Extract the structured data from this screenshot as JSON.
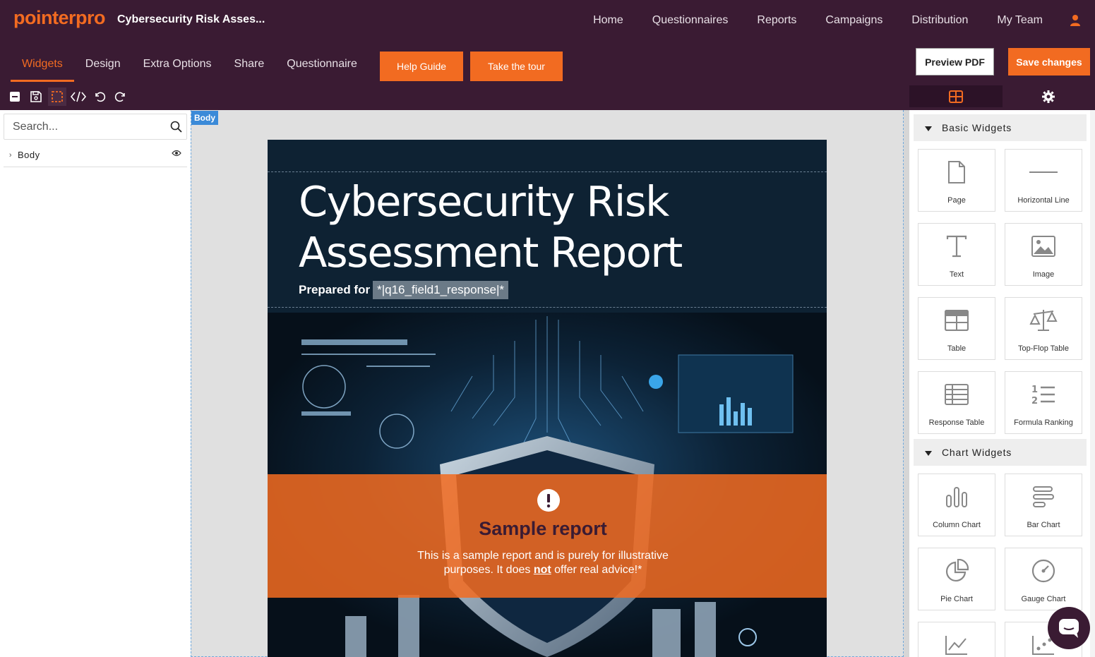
{
  "header": {
    "logo_text": "pointerpro",
    "app_title": "Cybersecurity Risk Asses...",
    "nav": [
      "Home",
      "Questionnaires",
      "Reports",
      "Campaigns",
      "Distribution",
      "My Team"
    ],
    "user_icon": "user-icon"
  },
  "subnav": {
    "tabs": [
      "Widgets",
      "Design",
      "Extra Options",
      "Share",
      "Questionnaire"
    ],
    "active_tab": "Widgets",
    "help_guide": "Help Guide",
    "take_tour": "Take the tour",
    "preview_pdf": "Preview PDF",
    "save_changes": "Save changes"
  },
  "toolbar": {
    "icons": [
      "collapse-icon",
      "save-icon",
      "select-outline-icon",
      "code-icon",
      "undo-icon",
      "redo-icon"
    ]
  },
  "right_tabs": [
    "widgets-grid-icon",
    "gear-icon"
  ],
  "left_panel": {
    "search_placeholder": "Search...",
    "tree": [
      {
        "label": "Body"
      }
    ]
  },
  "canvas": {
    "body_tag": "Body",
    "report_title": "Cybersecurity Risk Assessment Report",
    "prepared_label": "Prepared for",
    "prepared_value": "*|q16_field1_response|*",
    "sample_title": "Sample report",
    "sample_text_before": "This is a sample report and is purely for illustrative purposes. It does ",
    "sample_text_bold": "not",
    "sample_text_after": " offer real advice!*"
  },
  "right_panel": {
    "basic_title": "Basic Widgets",
    "basic_widgets": [
      "Page",
      "Horizontal Line",
      "Text",
      "Image",
      "Table",
      "Top-Flop Table",
      "Response Table",
      "Formula Ranking"
    ],
    "chart_title": "Chart Widgets",
    "chart_widgets": [
      "Column Chart",
      "Bar Chart",
      "Pie Chart",
      "Gauge Chart"
    ]
  },
  "colors": {
    "brand_orange": "#f26b21",
    "header_bg": "#3a1b33",
    "canvas_bg": "#0e2233"
  }
}
